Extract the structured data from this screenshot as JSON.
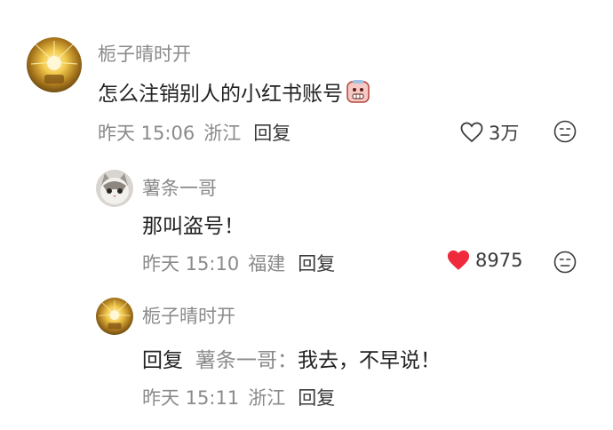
{
  "comments": [
    {
      "author": "栀子晴时开",
      "content": "怎么注销别人的小红书账号",
      "sticker_icon": "grimace-sticker-icon",
      "time": "昨天 15:06",
      "location": "浙江",
      "reply_label": "回复",
      "likes": "3万",
      "liked": false
    },
    {
      "author": "薯条一哥",
      "content": "那叫盗号！",
      "time": "昨天 15:10",
      "location": "福建",
      "reply_label": "回复",
      "likes": "8975",
      "liked": true
    },
    {
      "author": "栀子晴时开",
      "reply_prefix": "回复",
      "reply_target": "薯条一哥",
      "reply_colon": "：",
      "content": "我去，不早说！",
      "time": "昨天 15:11",
      "location": "浙江",
      "reply_label": "回复"
    }
  ],
  "colors": {
    "like_active": "#ee2a3c",
    "meta_gray": "#8a8a8a"
  }
}
